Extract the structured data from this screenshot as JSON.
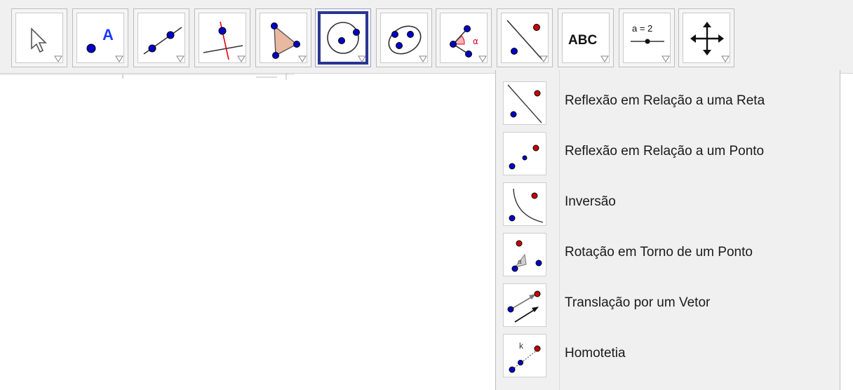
{
  "toolbar": {
    "tools": [
      {
        "name": "move-tool",
        "icon": "pointer-arrow-icon"
      },
      {
        "name": "point-tool",
        "icon": "point-icon",
        "glyph": "A"
      },
      {
        "name": "line-tool",
        "icon": "line-through-points-icon"
      },
      {
        "name": "perpendicular-line-tool",
        "icon": "perpendicular-line-icon"
      },
      {
        "name": "polygon-tool",
        "icon": "polygon-icon"
      },
      {
        "name": "circle-tool",
        "icon": "circle-center-point-icon",
        "selected": true
      },
      {
        "name": "conic-tool",
        "icon": "ellipse-icon"
      },
      {
        "name": "angle-tool",
        "icon": "angle-icon",
        "glyph": "α"
      },
      {
        "name": "reflect-tool",
        "icon": "reflect-line-icon"
      },
      {
        "name": "text-tool",
        "icon": "text-icon",
        "glyph": "ABC"
      },
      {
        "name": "slider-tool",
        "icon": "slider-icon",
        "glyph": "a = 2"
      },
      {
        "name": "move-graphics-tool",
        "icon": "move-graphics-icon"
      }
    ]
  },
  "menu": {
    "items": [
      {
        "label": "Reflexão em Relação a uma Reta",
        "icon": "reflect-about-line-icon"
      },
      {
        "label": "Reflexão em Relação a um Ponto",
        "icon": "reflect-about-point-icon"
      },
      {
        "label": "Inversão",
        "icon": "inversion-icon"
      },
      {
        "label": "Rotação em Torno de um Ponto",
        "icon": "rotate-around-point-icon",
        "glyph": "α"
      },
      {
        "label": "Translação por um Vetor",
        "icon": "translate-by-vector-icon"
      },
      {
        "label": "Homotetia",
        "icon": "dilate-icon",
        "glyph": "k"
      }
    ]
  },
  "colors": {
    "point_blue": "#0000c8",
    "point_red": "#c80000",
    "selected_border": "#2b3591",
    "polygon_fill": "#e8b9a0",
    "angle_red": "#e0002a"
  }
}
